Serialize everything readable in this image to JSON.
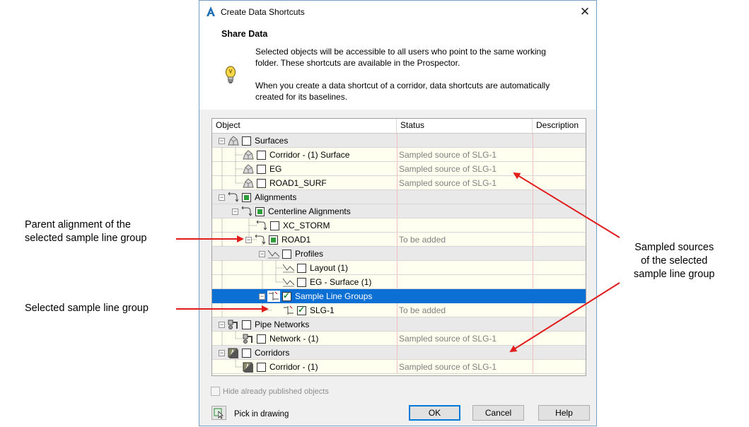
{
  "annotations": {
    "parent_alignment": [
      "Parent alignment of the",
      "selected sample line group"
    ],
    "selected_group": "Selected sample line group",
    "sampled_sources": [
      "Sampled sources",
      "of the selected",
      "sample line group"
    ]
  },
  "dialog": {
    "title": "Create Data Shortcuts",
    "section_title": "Share Data",
    "info_para1": [
      "Selected objects will be accessible to all users who point to the same working",
      "folder. These shortcuts are available in the Prospector."
    ],
    "info_para2": [
      "When you create a data shortcut of a corridor, data shortcuts are automatically",
      "created for its baselines."
    ],
    "columns": {
      "object": "Object",
      "status": "Status",
      "description": "Description"
    },
    "rows": [
      {
        "label": "Surfaces",
        "status": ""
      },
      {
        "label": "Corridor - (1) Surface",
        "status": "Sampled source of SLG-1"
      },
      {
        "label": "EG",
        "status": "Sampled source of SLG-1"
      },
      {
        "label": "ROAD1_SURF",
        "status": "Sampled source of SLG-1"
      },
      {
        "label": "Alignments",
        "status": ""
      },
      {
        "label": "Centerline Alignments",
        "status": ""
      },
      {
        "label": "XC_STORM",
        "status": ""
      },
      {
        "label": "ROAD1",
        "status": "To be added"
      },
      {
        "label": "Profiles",
        "status": ""
      },
      {
        "label": "Layout (1)",
        "status": ""
      },
      {
        "label": "EG - Surface (1)",
        "status": ""
      },
      {
        "label": "Sample Line Groups",
        "status": ""
      },
      {
        "label": "SLG-1",
        "status": "To be added"
      },
      {
        "label": "Pipe Networks",
        "status": ""
      },
      {
        "label": "Network - (1)",
        "status": "Sampled source of SLG-1"
      },
      {
        "label": "Corridors",
        "status": ""
      },
      {
        "label": "Corridor - (1)",
        "status": "Sampled source of SLG-1"
      }
    ],
    "hide_published_label": "Hide already published objects",
    "pick_label": "Pick in drawing",
    "buttons": {
      "ok": "OK",
      "cancel": "Cancel",
      "help": "Help"
    }
  },
  "colors": {
    "accent_selected": "#0c6fd4",
    "arrow": "#e21b1b",
    "partial_check": "#2e9f3a"
  }
}
